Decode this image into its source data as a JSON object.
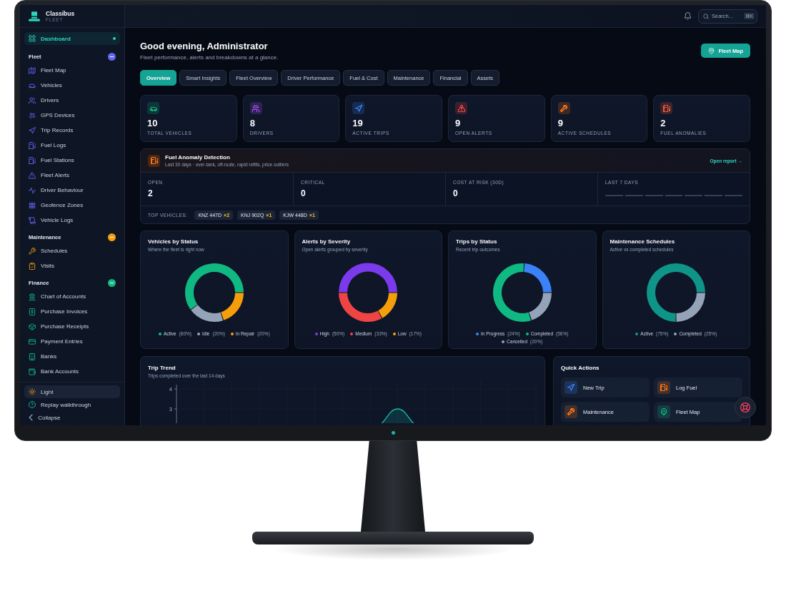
{
  "brand": {
    "name": "Classibus",
    "tagline": "FLEET"
  },
  "sidebar": {
    "items": [
      {
        "label": "Dashboard",
        "selected": true
      }
    ],
    "sections": [
      {
        "title": "Fleet",
        "color": "#6366f1",
        "expanded": true,
        "items": [
          {
            "label": "Fleet Map",
            "selected": false
          },
          {
            "label": "Vehicles",
            "selected": false
          },
          {
            "label": "Drivers",
            "selected": false
          },
          {
            "label": "GPS Devices",
            "selected": false
          },
          {
            "label": "Trip Records",
            "selected": false
          },
          {
            "label": "Fuel Logs",
            "selected": false
          },
          {
            "label": "Fuel Stations",
            "selected": false
          },
          {
            "label": "Fleet Alerts",
            "selected": false
          },
          {
            "label": "Driver Behaviour",
            "selected": false
          },
          {
            "label": "Geofence Zones",
            "selected": false
          },
          {
            "label": "Vehicle Logs",
            "selected": false
          }
        ]
      },
      {
        "title": "Maintenance",
        "color": "#f59e0b",
        "expanded": true,
        "items": [
          {
            "label": "Schedules",
            "selected": false
          },
          {
            "label": "Visits",
            "selected": false
          }
        ]
      },
      {
        "title": "Finance",
        "color": "#10b981",
        "expanded": true,
        "items": [
          {
            "label": "Chart of Accounts",
            "selected": false
          },
          {
            "label": "Purchase Invoices",
            "selected": false
          },
          {
            "label": "Purchase Receipts",
            "selected": false
          },
          {
            "label": "Payment Entries",
            "selected": false
          },
          {
            "label": "Banks",
            "selected": false
          },
          {
            "label": "Bank Accounts",
            "selected": false
          }
        ]
      }
    ],
    "footer": [
      {
        "label": "Light",
        "kind": "theme"
      },
      {
        "label": "Replay walkthrough",
        "kind": "link"
      },
      {
        "label": "Collapse",
        "kind": "link"
      }
    ]
  },
  "top_bar": {
    "search": {
      "placeholder": "Search...",
      "shortcut": "⌘K"
    }
  },
  "header": {
    "title": "Good evening, Administrator",
    "subtitle": "Fleet performance, alerts and breakdowns at a glance.",
    "action": "Fleet Map"
  },
  "tabs": [
    {
      "label": "Overview",
      "selected": true
    },
    {
      "label": "Smart Insights",
      "selected": false
    },
    {
      "label": "Fleet Overview",
      "selected": false
    },
    {
      "label": "Driver Performance",
      "selected": false
    },
    {
      "label": "Fuel & Cost",
      "selected": false
    },
    {
      "label": "Maintenance",
      "selected": false
    },
    {
      "label": "Financial",
      "selected": false
    },
    {
      "label": "Assets",
      "selected": false
    }
  ],
  "stats": [
    {
      "value": "10",
      "label": "TOTAL VEHICLES",
      "color": "#10b981"
    },
    {
      "value": "8",
      "label": "DRIVERS",
      "color": "#a855f7"
    },
    {
      "value": "19",
      "label": "ACTIVE TRIPS",
      "color": "#3b82f6"
    },
    {
      "value": "9",
      "label": "OPEN ALERTS",
      "color": "#ef4444"
    },
    {
      "value": "9",
      "label": "ACTIVE SCHEDULES",
      "color": "#f97316"
    },
    {
      "value": "2",
      "label": "FUEL ANOMALIES",
      "color": "#f05a3c"
    }
  ],
  "fuel_anomaly": {
    "title": "Fuel Anomaly Detection",
    "subtitle": "Last 30 days · over-tank, off-route, rapid refills, price outliers",
    "link": "Open report →",
    "metrics": [
      {
        "label": "OPEN",
        "value": "2"
      },
      {
        "label": "CRITICAL",
        "value": "0"
      },
      {
        "label": "COST AT RISK (30D)",
        "value": "0"
      }
    ],
    "trend_label": "LAST 7 DAYS",
    "top_vehicles_label": "TOP VEHICLES:",
    "top_vehicles": [
      {
        "plate": "KNZ 447D",
        "count": "×2"
      },
      {
        "plate": "KNJ 902Q",
        "count": "×1"
      },
      {
        "plate": "KJW 448D",
        "count": "×1"
      }
    ]
  },
  "charts": [
    {
      "title": "Vehicles by Status",
      "subtitle": "Where the fleet is right now",
      "chart_data": {
        "type": "donut",
        "categories": [
          "Active",
          "Idle",
          "In Repair"
        ],
        "values": [
          60,
          20,
          20
        ]
      },
      "legend": [
        {
          "share": "(60%)",
          "color": "#10b981"
        },
        {
          "share": "(20%)",
          "color": "#94a3b8"
        },
        {
          "share": "(20%)",
          "color": "#f59e0b"
        }
      ]
    },
    {
      "title": "Alerts by Severity",
      "subtitle": "Open alerts grouped by severity",
      "chart_data": {
        "type": "donut",
        "categories": [
          "High",
          "Medium",
          "Low"
        ],
        "values": [
          50,
          33,
          17
        ]
      },
      "legend": [
        {
          "share": "(50%)",
          "color": "#7c3aed"
        },
        {
          "share": "(33%)",
          "color": "#ef4444"
        },
        {
          "share": "(17%)",
          "color": "#f59e0b"
        }
      ]
    },
    {
      "title": "Trips by Status",
      "subtitle": "Recent trip outcomes",
      "chart_data": {
        "type": "donut",
        "categories": [
          "In Progress",
          "Completed",
          "Cancelled"
        ],
        "values": [
          24,
          56,
          20
        ]
      },
      "legend": [
        {
          "share": "(24%)",
          "color": "#3b82f6"
        },
        {
          "share": "(56%)",
          "color": "#10b981"
        },
        {
          "share": "(20%)",
          "color": "#94a3b8"
        }
      ]
    },
    {
      "title": "Maintenance Schedules",
      "subtitle": "Active vs completed schedules",
      "chart_data": {
        "type": "donut",
        "categories": [
          "Active",
          "Completed"
        ],
        "values": [
          75,
          25
        ]
      },
      "legend": [
        {
          "share": "(75%)",
          "color": "#0f9488"
        },
        {
          "share": "(25%)",
          "color": "#94a3b8"
        }
      ]
    }
  ],
  "trip_trend": {
    "title": "Trip Trend",
    "subtitle": "Trips completed over the last 14 days",
    "y_tick_labels": [
      "4",
      "3"
    ]
  },
  "quick_actions": {
    "title": "Quick Actions",
    "actions": [
      {
        "label": "New Trip",
        "color": "#3b82f6"
      },
      {
        "label": "Log Fuel",
        "color": "#f97316"
      },
      {
        "label": "Maintenance",
        "color": "#f97316"
      },
      {
        "label": "Fleet Map",
        "color": "#10b981"
      }
    ]
  }
}
